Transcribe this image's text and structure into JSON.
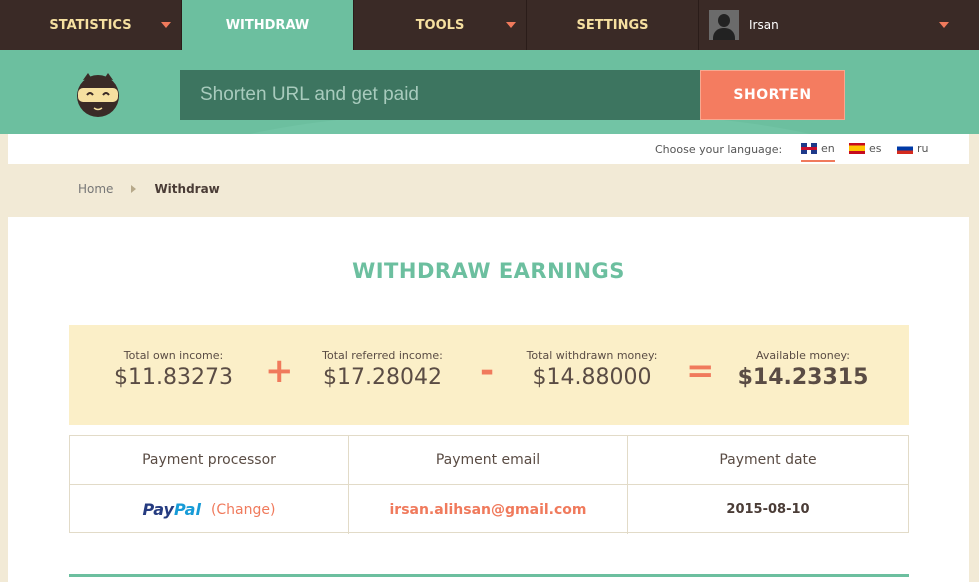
{
  "nav": {
    "items": [
      {
        "label": "STATISTICS",
        "has_caret": true
      },
      {
        "label": "WITHDRAW",
        "has_caret": false,
        "active": true
      },
      {
        "label": "TOOLS",
        "has_caret": true
      },
      {
        "label": "SETTINGS",
        "has_caret": false
      }
    ],
    "user": {
      "name": "Irsan"
    }
  },
  "shortener": {
    "placeholder": "Shorten URL and get paid",
    "button_label": "SHORTEN"
  },
  "language": {
    "label": "Choose your language:",
    "options": [
      {
        "code": "en",
        "selected": true
      },
      {
        "code": "es",
        "selected": false
      },
      {
        "code": "ru",
        "selected": false
      }
    ]
  },
  "breadcrumb": {
    "home": "Home",
    "current": "Withdraw"
  },
  "page_title": "WITHDRAW EARNINGS",
  "summary": {
    "own": {
      "label": "Total own income:",
      "value": "$11.83273"
    },
    "op1": "+",
    "referred": {
      "label": "Total referred income:",
      "value": "$17.28042"
    },
    "op2": "-",
    "withdrawn": {
      "label": "Total withdrawn money:",
      "value": "$14.88000"
    },
    "op3": "=",
    "available": {
      "label": "Available money:",
      "value": "$14.23315"
    }
  },
  "payment_table": {
    "headers": [
      "Payment processor",
      "Payment email",
      "Payment date"
    ],
    "row": {
      "processor_logo_1": "Pay",
      "processor_logo_2": "Pal",
      "change_label": "(Change)",
      "email": "irsan.alihsan@gmail.com",
      "date": "2015-08-10"
    }
  },
  "colors": {
    "nav_bg": "#3a2a26",
    "accent_green": "#6cbf9f",
    "accent_orange": "#f47c60",
    "summary_bg": "#fbefc8"
  }
}
